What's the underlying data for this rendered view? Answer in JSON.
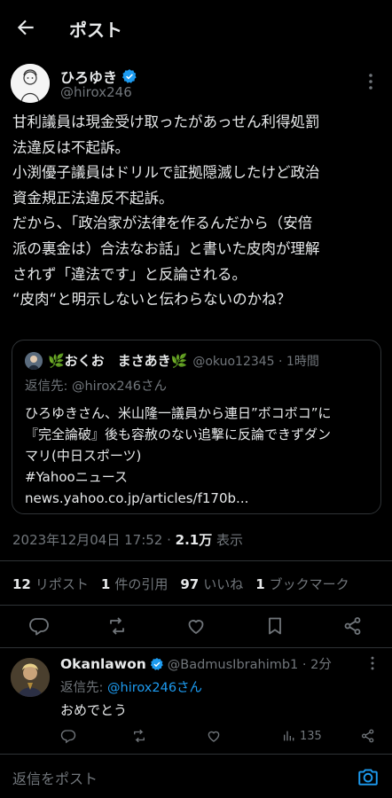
{
  "header": {
    "title": "ポスト"
  },
  "post": {
    "author_name": "ひろゆき",
    "author_handle": "@hirox246",
    "text": "甘利議員は現金受け取ったがあっせん利得処罰\n法違反は不起訴。\n小渕優子議員はドリルで証拠隠滅したけど政治\n資金規正法違反不起訴。\nだから、「政治家が法律を作るんだから（安倍\n派の裏金は）合法なお話」と書いた皮肉が理解\nされず「違法です」と反論される。\n“皮肉“と明示しないと伝わらないのかね？",
    "timestamp": "2023年12月04日 17:52 · ",
    "views_count": "2.1万",
    "views_label": " 表示"
  },
  "quote": {
    "name": "🌿おくお　まさあき🌿",
    "meta": "@okuo12345 · 1時間",
    "reply_to": "返信先: @hirox246さん",
    "text": "ひろゆきさん、米山隆一議員から連日”ボコボコ”に\n『完全論破』後も容赦のない追撃に反論できずダン\nマリ(中日スポーツ)\n#Yahooニュース\nnews.yahoo.co.jp/articles/f170b..."
  },
  "stats": {
    "reposts_num": "12",
    "reposts_label": "リポスト",
    "quotes_num": "1",
    "quotes_label": "件の引用",
    "likes_num": "97",
    "likes_label": "いいね",
    "bookmarks_num": "1",
    "bookmarks_label": "ブックマーク"
  },
  "reply": {
    "name": "Okanlawon",
    "meta": "@BadmusIbrahimb1 · 2分",
    "reply_to_prefix": "返信先: ",
    "reply_to_link": "@hirox246さん",
    "text": "おめでとう",
    "views": "135"
  },
  "composer": {
    "placeholder": "返信をポスト"
  },
  "colors": {
    "background": "#000000",
    "text": "#e7e9ea",
    "muted": "#71767b",
    "accent": "#1d9bf0",
    "verified": "#1d9bf0"
  },
  "icons": [
    "back-arrow-icon",
    "verified-badge-icon",
    "more-icon",
    "reply-icon",
    "repost-icon",
    "like-icon",
    "bookmark-icon",
    "share-icon",
    "views-icon",
    "camera-icon"
  ]
}
